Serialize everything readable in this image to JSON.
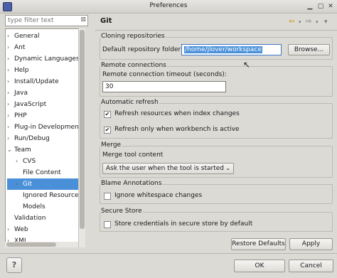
{
  "window": {
    "title": "Preferences"
  },
  "filter": {
    "placeholder": "type filter text"
  },
  "tree": {
    "items": [
      {
        "label": "General",
        "twisty": "›"
      },
      {
        "label": "Ant",
        "twisty": "›"
      },
      {
        "label": "Dynamic Languages",
        "twisty": "›"
      },
      {
        "label": "Help",
        "twisty": "›"
      },
      {
        "label": "Install/Update",
        "twisty": "›"
      },
      {
        "label": "Java",
        "twisty": "›"
      },
      {
        "label": "JavaScript",
        "twisty": "›"
      },
      {
        "label": "PHP",
        "twisty": "›"
      },
      {
        "label": "Plug-in Development",
        "twisty": "›"
      },
      {
        "label": "Run/Debug",
        "twisty": "›"
      },
      {
        "label": "Team",
        "twisty": "⌄"
      },
      {
        "label": "CVS",
        "twisty": "›"
      },
      {
        "label": "File Content",
        "twisty": ""
      },
      {
        "label": "Git",
        "twisty": "›"
      },
      {
        "label": "Ignored Resources",
        "twisty": ""
      },
      {
        "label": "Models",
        "twisty": ""
      },
      {
        "label": "Validation",
        "twisty": ""
      },
      {
        "label": "Web",
        "twisty": "›"
      },
      {
        "label": "XML",
        "twisty": "›"
      }
    ]
  },
  "page": {
    "title": "Git"
  },
  "cloning": {
    "group": "Cloning repositories",
    "label": "Default repository folder:",
    "value": "/home/jlover/workspace",
    "browse": "Browse..."
  },
  "remote": {
    "group": "Remote connections",
    "label": "Remote connection timeout (seconds):",
    "value": "30"
  },
  "refresh": {
    "group": "Automatic refresh",
    "option1": "Refresh resources when index changes",
    "option2": "Refresh only when workbench is active"
  },
  "merge": {
    "group": "Merge",
    "label": "Merge tool content",
    "selected": "Ask the user when the tool is started"
  },
  "blame": {
    "group": "Blame Annotations",
    "option": "Ignore whitespace changes"
  },
  "secure": {
    "group": "Secure Store",
    "option": "Store credentials in secure store by default"
  },
  "buttons": {
    "restore": "Restore Defaults",
    "apply": "Apply",
    "ok": "OK",
    "cancel": "Cancel",
    "help": "?"
  }
}
